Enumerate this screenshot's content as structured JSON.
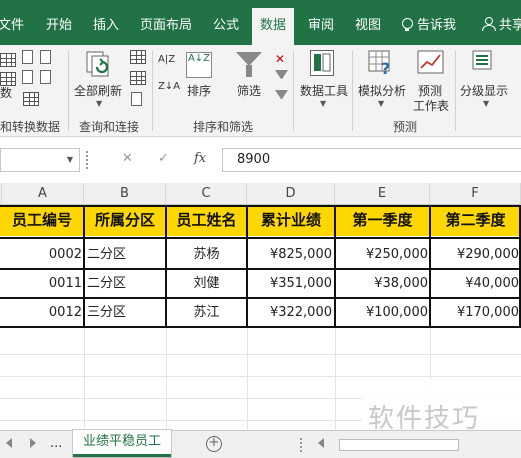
{
  "ribbon_tabs": [
    "文件",
    "开始",
    "插入",
    "页面布局",
    "公式",
    "数据",
    "审阅",
    "视图",
    "告诉我",
    "共享"
  ],
  "active_tab": "数据",
  "ribbon": {
    "get_data_btn": "数",
    "group_get_data": "和转换数据",
    "refresh_all": "全部刷新",
    "group_queries": "查询和连接",
    "sort": "排序",
    "filter": "筛选",
    "group_sort_filter": "排序和筛选",
    "data_tools": "数据工具",
    "what_if": "模拟分析",
    "forecast_sheet_line1": "预测",
    "forecast_sheet_line2": "工作表",
    "group_forecast": "预测",
    "outline": "分级显示",
    "sort_az_icon": "A↓Z",
    "sort_za_icon": "Z↓A",
    "sort_az_small": "A|Z"
  },
  "formula_bar": {
    "value": "8900",
    "cancel_glyph": "✕",
    "enter_glyph": "✓",
    "fx_glyph": "fx"
  },
  "columns": [
    "A",
    "B",
    "C",
    "D",
    "E",
    "F"
  ],
  "table": {
    "headers": [
      "员工编号",
      "所属分区",
      "员工姓名",
      "累计业绩",
      "第一季度",
      "第二季度"
    ],
    "rows": [
      [
        "0002",
        "二分区",
        "苏杨",
        "¥825,000",
        "¥250,000",
        "¥290,000"
      ],
      [
        "0011",
        "二分区",
        "刘健",
        "¥351,000",
        "¥38,000",
        "¥40,000"
      ],
      [
        "0012",
        "三分区",
        "苏江",
        "¥322,000",
        "¥100,000",
        "¥170,000"
      ]
    ]
  },
  "sheet_tabs": {
    "ellipsis": "...",
    "active": "业绩平稳员工",
    "add": "+"
  },
  "watermark": "软件技巧",
  "colors": {
    "excel_green": "#217346",
    "header_fill": "#ffd700"
  }
}
